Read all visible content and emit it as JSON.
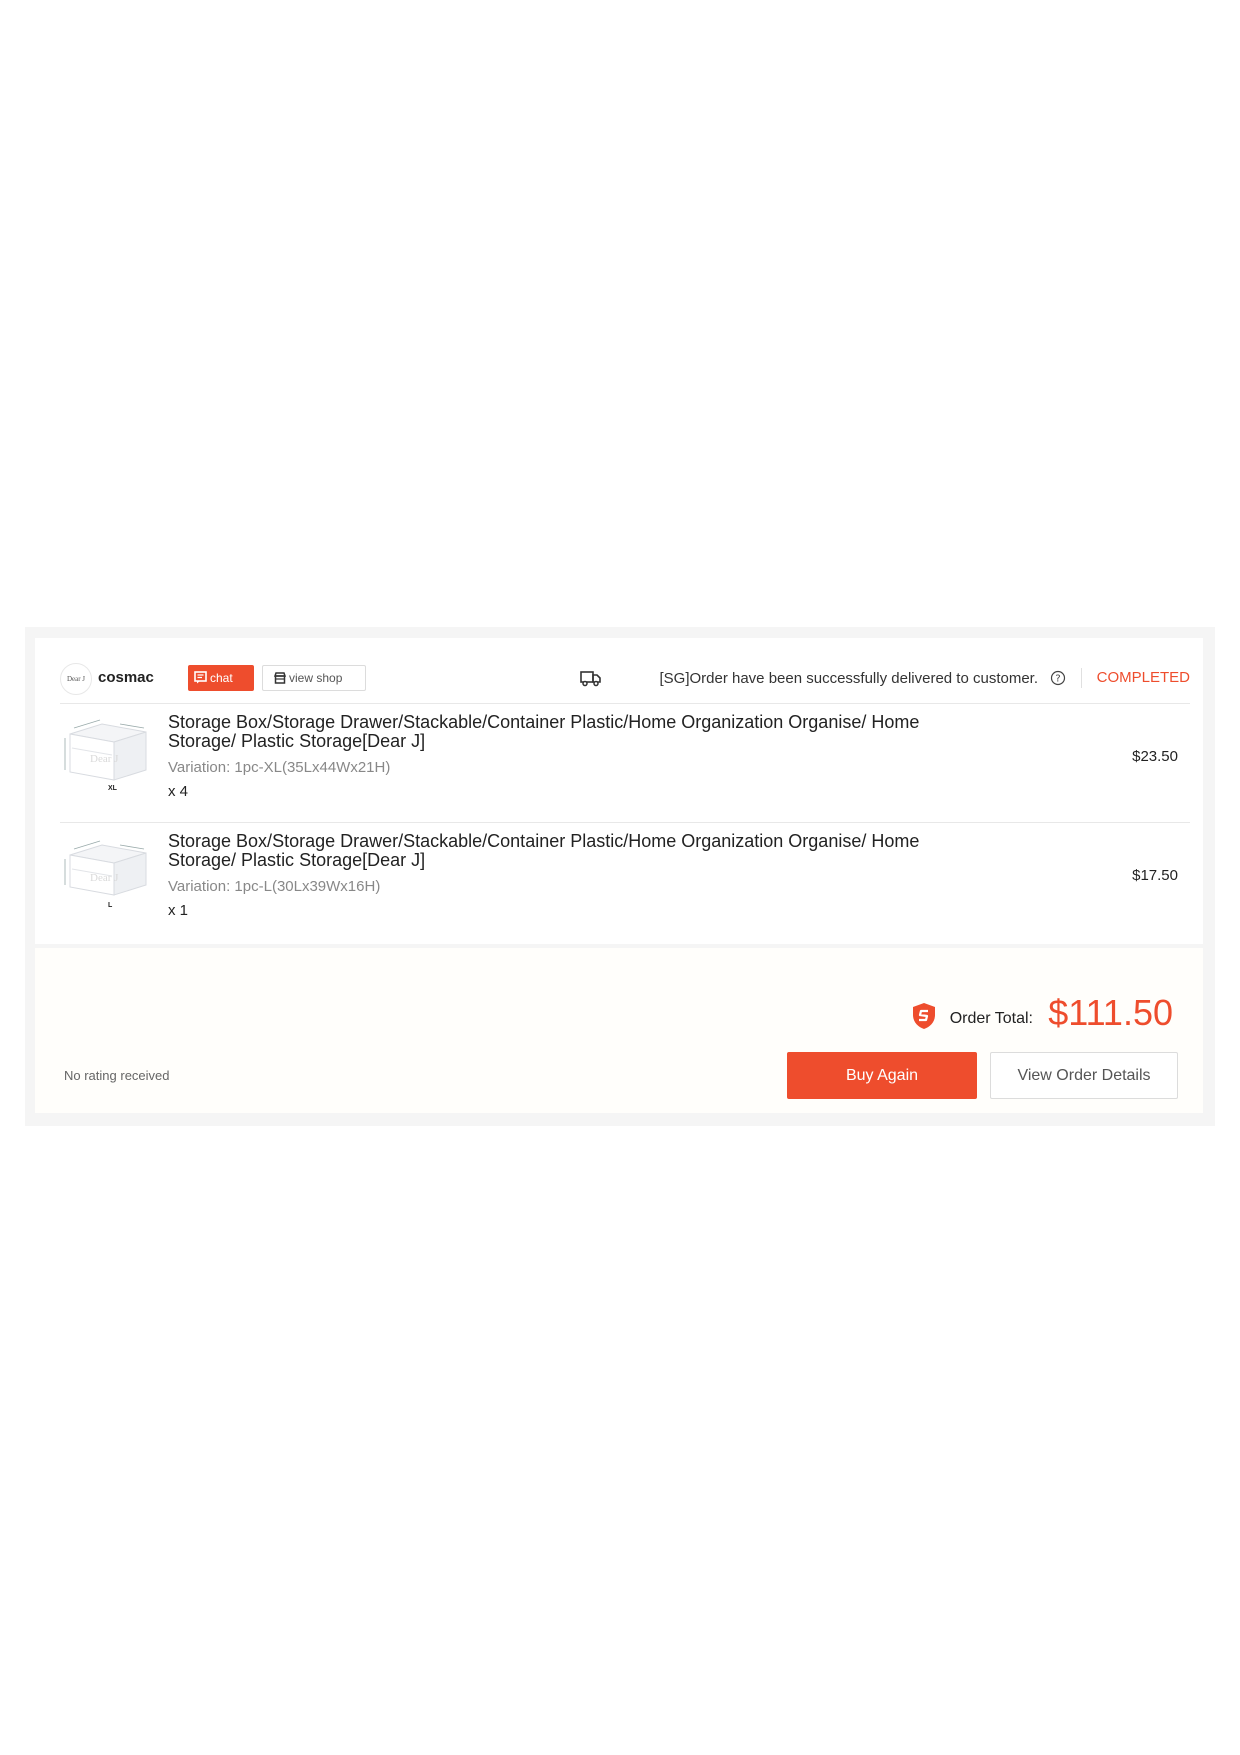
{
  "shop": {
    "logo_text": "Dear J",
    "name": "cosmac",
    "chat_label": "chat",
    "view_shop_label": "view shop"
  },
  "order": {
    "delivery_message": "[SG]Order have been successfully delivered to customer.",
    "status": "COMPLETED"
  },
  "items": [
    {
      "title": "Storage Box/Storage Drawer/Stackable/Container Plastic/Home Organization Organise/ Home Storage/ Plastic Storage[Dear J]",
      "variation": "Variation: 1pc-XL(35Lx44Wx21H)",
      "quantity": "x 4",
      "price": "$23.50",
      "thumb_size_label": "XL",
      "thumb_brand": "Dear J"
    },
    {
      "title": "Storage Box/Storage Drawer/Stackable/Container Plastic/Home Organization Organise/ Home Storage/ Plastic Storage[Dear J]",
      "variation": "Variation: 1pc-L(30Lx39Wx16H)",
      "quantity": "x 1",
      "price": "$17.50",
      "thumb_size_label": "L",
      "thumb_brand": "Dear J"
    }
  ],
  "summary": {
    "total_label": "Order Total:",
    "total_value": "$111.50",
    "rating_text": "No rating received",
    "buy_again_label": "Buy Again",
    "view_details_label": "View Order Details"
  },
  "colors": {
    "accent": "#ee4d2d",
    "bottom_bg": "#fffefb"
  }
}
